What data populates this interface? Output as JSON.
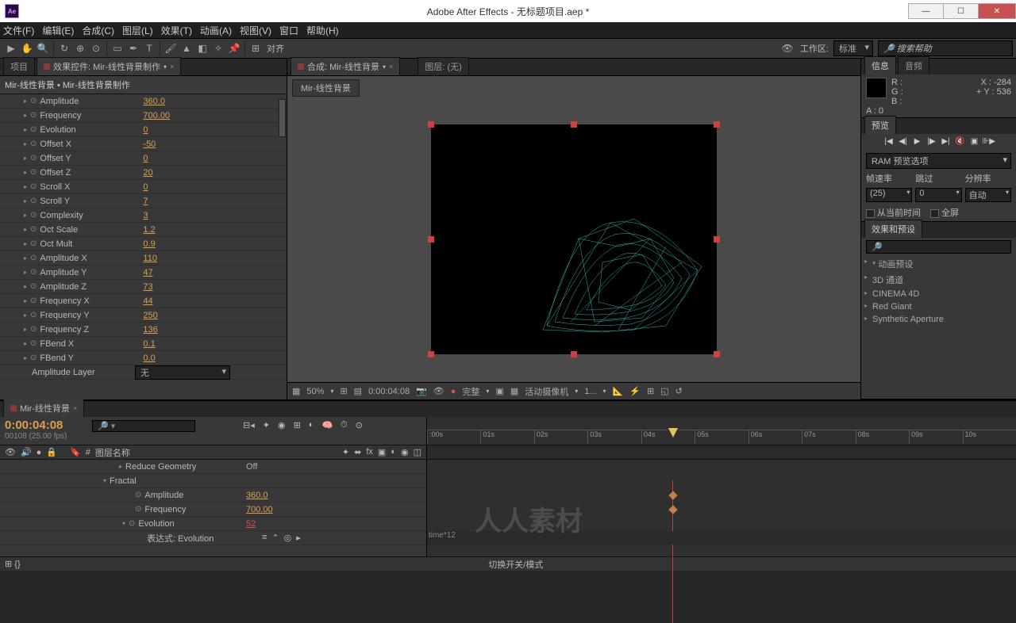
{
  "title": "Adobe After Effects - 无标题项目.aep *",
  "menu": [
    "文件(F)",
    "编辑(E)",
    "合成(C)",
    "图层(L)",
    "效果(T)",
    "动画(A)",
    "视图(V)",
    "窗口",
    "帮助(H)"
  ],
  "toolbar": {
    "snap": "对齐",
    "workspace_label": "工作区:",
    "workspace": "标准",
    "search_ph": "搜索帮助"
  },
  "left": {
    "tab_project": "项目",
    "tab_fx": "效果控件: Mir-线性背景制作",
    "header": "Mir-线性背景 • Mir-线性背景制作",
    "rows": [
      {
        "name": "Amplitude",
        "val": "360.0"
      },
      {
        "name": "Frequency",
        "val": "700.00"
      },
      {
        "name": "Evolution",
        "val": "0"
      },
      {
        "name": "Offset X",
        "val": "-50"
      },
      {
        "name": "Offset Y",
        "val": "0"
      },
      {
        "name": "Offset Z",
        "val": "20"
      },
      {
        "name": "Scroll X",
        "val": "0"
      },
      {
        "name": "Scroll Y",
        "val": "7"
      },
      {
        "name": "Complexity",
        "val": "3"
      },
      {
        "name": "Oct Scale",
        "val": "1.2"
      },
      {
        "name": "Oct Mult",
        "val": "0.9"
      },
      {
        "name": "Amplitude X",
        "val": "110"
      },
      {
        "name": "Amplitude Y",
        "val": "47"
      },
      {
        "name": "Amplitude Z",
        "val": "73"
      },
      {
        "name": "Frequency X",
        "val": "44"
      },
      {
        "name": "Frequency Y",
        "val": "250"
      },
      {
        "name": "Frequency Z",
        "val": "136"
      },
      {
        "name": "FBend X",
        "val": "0.1"
      },
      {
        "name": "FBend Y",
        "val": "0.0"
      }
    ],
    "amp_layer_label": "Amplitude Layer",
    "amp_layer_val": "无"
  },
  "center": {
    "tab_comp": "合成: Mir-线性背景",
    "tab_layer": "图层: (无)",
    "subtab": "Mir-线性背景",
    "footer": {
      "zoom": "50%",
      "tc": "0:00:04:08",
      "full": "完整",
      "cam": "活动摄像机",
      "views": "1..."
    }
  },
  "right": {
    "info_tab": "信息",
    "audio_tab": "音频",
    "info": {
      "r": "R :",
      "g": "G :",
      "b": "B :",
      "a": "A : 0",
      "x": "X : -284",
      "y": "Y : 536"
    },
    "preview_tab": "预览",
    "ram": "RAM 预览选项",
    "fr_label": "帧速率",
    "skip_label": "跳过",
    "res_label": "分辨率",
    "fr": "(25)",
    "skip": "0",
    "res": "自动",
    "from_current": "从当前时间",
    "fullscreen": "全屏",
    "fxp_tab": "效果和预设",
    "presets": [
      "* 动画预设",
      "3D 通道",
      "CINEMA 4D",
      "Red Giant",
      "Synthetic Aperture"
    ]
  },
  "timeline": {
    "tab": "Mir-线性背景",
    "tc": "0:00:04:08",
    "tc_sub": "00108 (25.00 fps)",
    "col_layer": "图层名称",
    "ticks": [
      ":00s",
      "01s",
      "02s",
      "03s",
      "04s",
      "05s",
      "06s",
      "07s",
      "08s",
      "09s",
      "10s"
    ],
    "rows": {
      "reduce": "Reduce Geometry",
      "reduce_val": "Off",
      "fractal": "Fractal",
      "amp": "Amplitude",
      "amp_val": "360.0",
      "freq": "Frequency",
      "freq_val": "700.00",
      "evo": "Evolution",
      "evo_val": "52",
      "expr": "表达式: Evolution",
      "expr_code": "time*12"
    },
    "footer": "切换开关/模式"
  },
  "watermark": "人人素材"
}
